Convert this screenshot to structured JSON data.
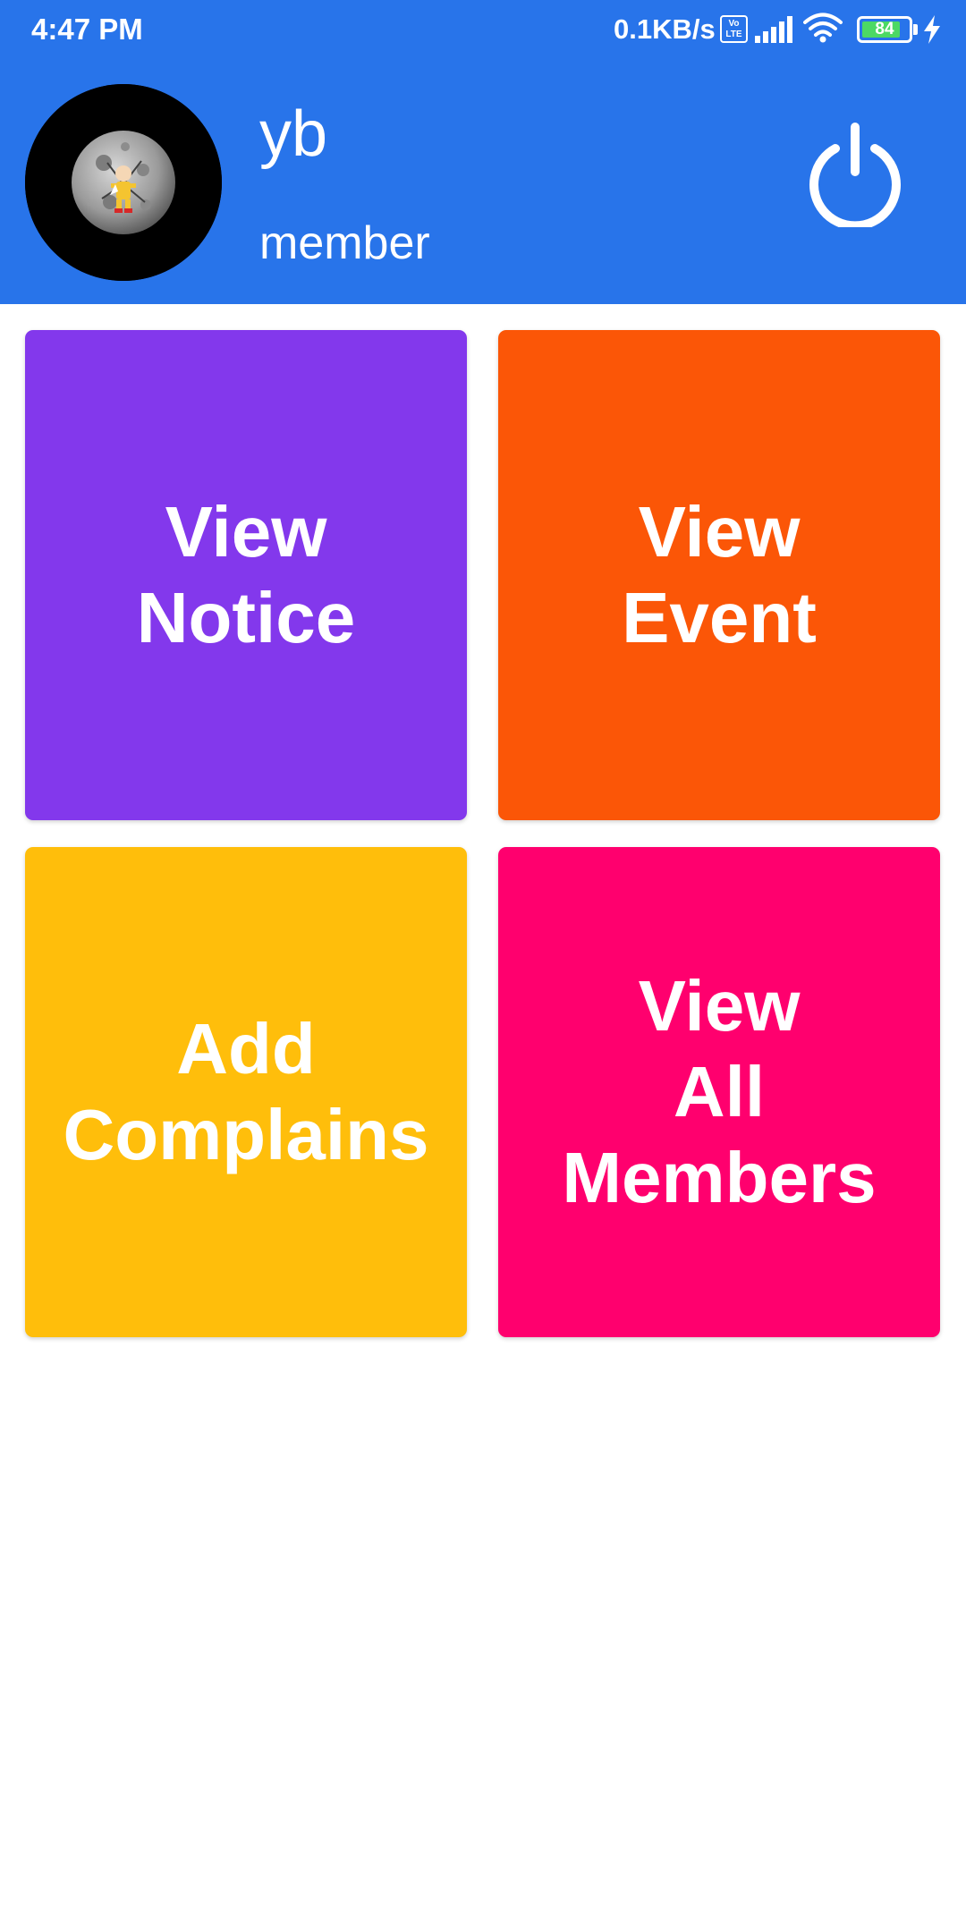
{
  "status_bar": {
    "time": "4:47 PM",
    "network_speed": "0.1KB/s",
    "volte_badge": "Vo LTE",
    "battery_level": "84",
    "battery_fraction": 0.84,
    "icons": [
      "volte-icon",
      "signal-icon",
      "wifi-icon",
      "battery-icon",
      "charging-bolt-icon"
    ]
  },
  "profile": {
    "name": "yb",
    "role": "member",
    "avatar_icon": "moon-character-avatar",
    "logout_icon": "power-icon"
  },
  "tiles": [
    {
      "label": "View\nNotice",
      "color": "#8338ec"
    },
    {
      "label": "View\nEvent",
      "color": "#fb5607"
    },
    {
      "label": "Add\nComplains",
      "color": "#ffbe0b"
    },
    {
      "label": "View\nAll\nMembers",
      "color": "#ff006e"
    }
  ],
  "colors": {
    "header_background": "#2874ea",
    "page_background": "#ffffff",
    "text_on_color": "#ffffff"
  }
}
